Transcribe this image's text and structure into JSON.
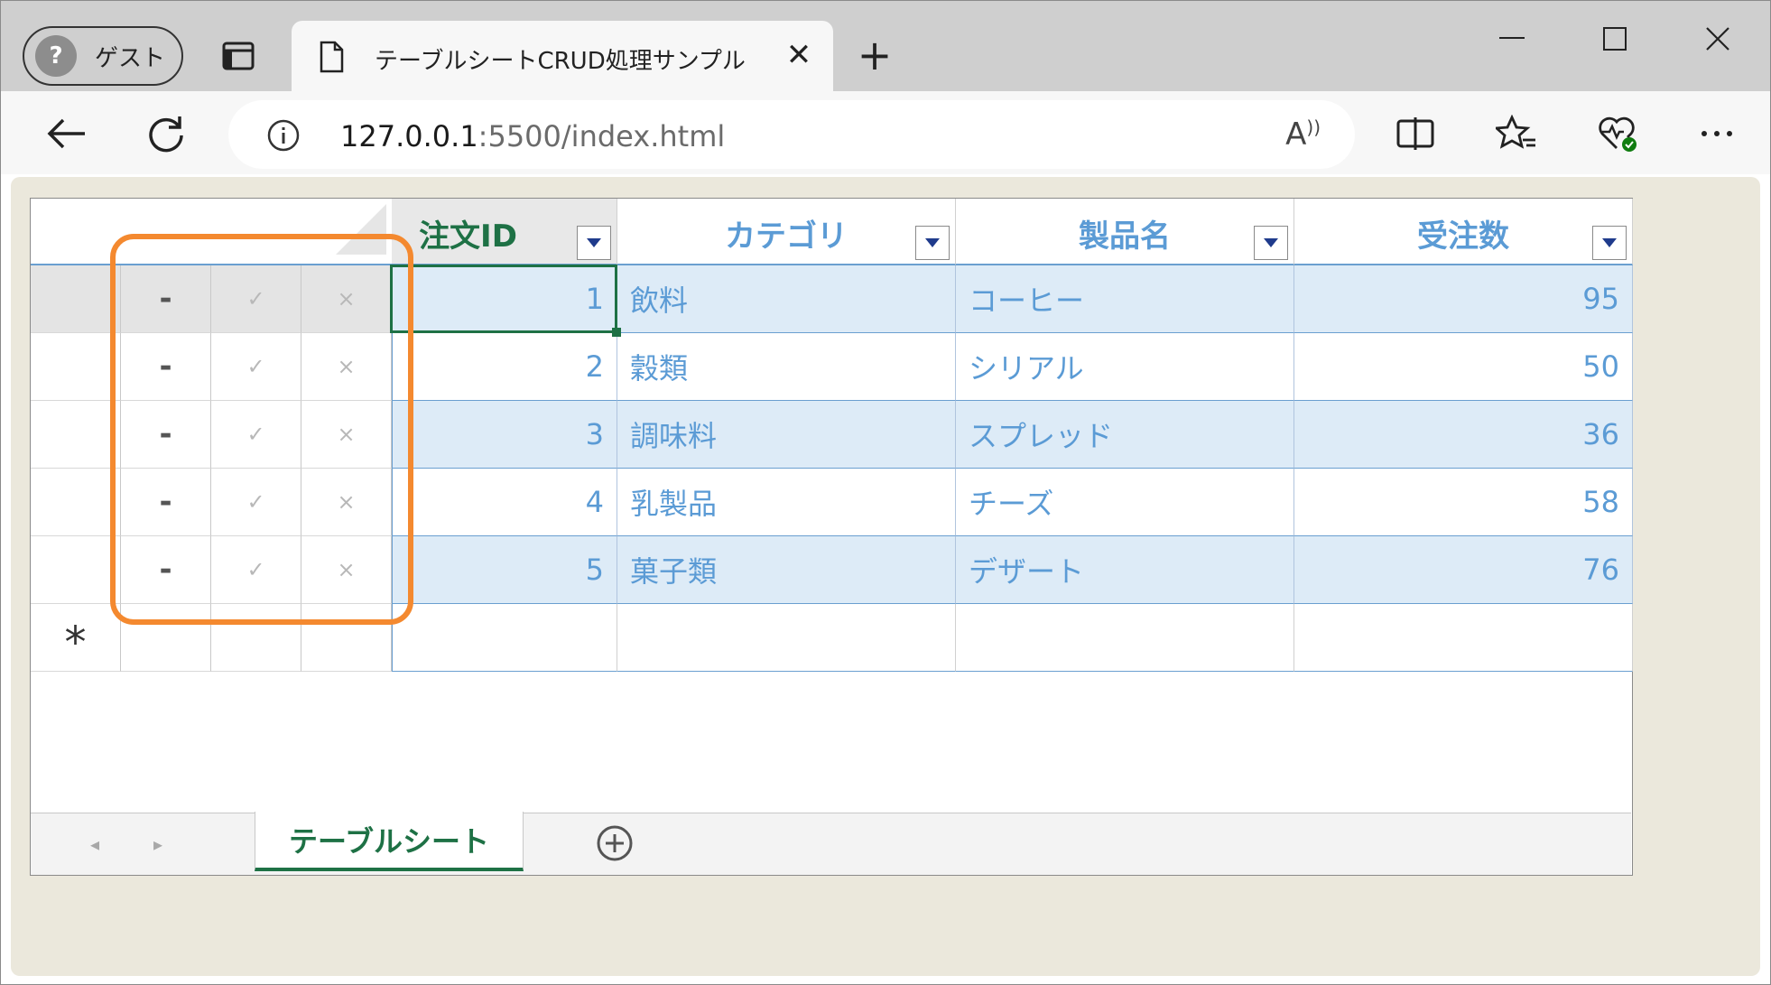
{
  "browser": {
    "profile_label": "ゲスト",
    "tab_title": "テーブルシートCRUD処理サンプル",
    "tab_close": "✕",
    "new_tab": "+",
    "url_host": "127.0.0.1",
    "url_path": ":5500/index.html",
    "read_aloud": "A"
  },
  "table": {
    "columns": [
      "注文ID",
      "カテゴリ",
      "製品名",
      "受注数"
    ],
    "rows": [
      [
        "1",
        "飲料",
        "コーヒー",
        "95"
      ],
      [
        "2",
        "穀類",
        "シリアル",
        "50"
      ],
      [
        "3",
        "調味料",
        "スプレッド",
        "36"
      ],
      [
        "4",
        "乳製品",
        "チーズ",
        "58"
      ],
      [
        "5",
        "菓子類",
        "デザート",
        "76"
      ]
    ],
    "command_glyphs": {
      "remove": "-",
      "save": "✓",
      "cancel": "×"
    },
    "new_row_marker": "*",
    "highlight_color": "#f4892f"
  },
  "sheet_tabs": {
    "active": "テーブルシート",
    "prev": "◂",
    "next": "▸"
  },
  "colors": {
    "accent_green": "#1e7145",
    "header_blue": "#5b9bd5",
    "band_blue": "#ddebf7",
    "page_bg": "#ebe8dc"
  }
}
